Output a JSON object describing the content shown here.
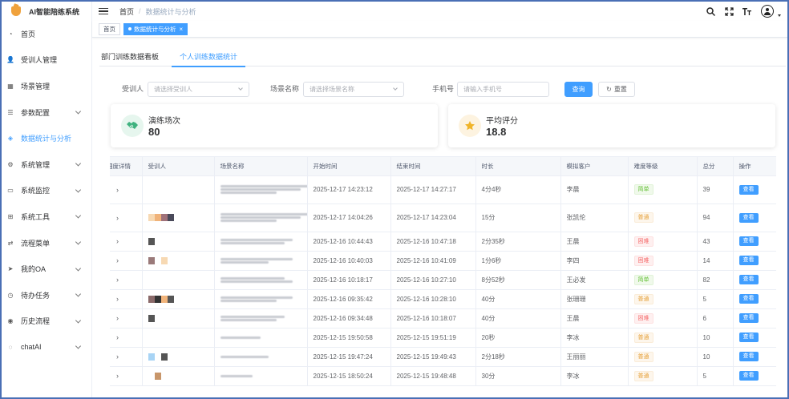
{
  "app": {
    "title": "AI智能陪练系统"
  },
  "sidebar": {
    "items": [
      {
        "label": "首页",
        "icon": "dashboard-icon",
        "glyph": "◔",
        "has_children": false,
        "active": false
      },
      {
        "label": "受训人管理",
        "icon": "user-icon",
        "glyph": "👤",
        "has_children": false,
        "active": false
      },
      {
        "label": "场景管理",
        "icon": "table-icon",
        "glyph": "▦",
        "has_children": false,
        "active": false
      },
      {
        "label": "参数配置",
        "icon": "sliders-icon",
        "glyph": "☰",
        "has_children": true,
        "active": false
      },
      {
        "label": "数据统计与分析",
        "icon": "chart-icon",
        "glyph": "◈",
        "has_children": false,
        "active": true
      },
      {
        "label": "系统管理",
        "icon": "gear-icon",
        "glyph": "⚙",
        "has_children": true,
        "active": false
      },
      {
        "label": "系统监控",
        "icon": "monitor-icon",
        "glyph": "▭",
        "has_children": true,
        "active": false
      },
      {
        "label": "系统工具",
        "icon": "toolbox-icon",
        "glyph": "⊞",
        "has_children": true,
        "active": false
      },
      {
        "label": "流程菜单",
        "icon": "flow-icon",
        "glyph": "⇄",
        "has_children": true,
        "active": false
      },
      {
        "label": "我的OA",
        "icon": "send-icon",
        "glyph": "➤",
        "has_children": true,
        "active": false
      },
      {
        "label": "待办任务",
        "icon": "task-icon",
        "glyph": "◷",
        "has_children": true,
        "active": false
      },
      {
        "label": "历史流程",
        "icon": "eye-icon",
        "glyph": "◉",
        "has_children": true,
        "active": false
      },
      {
        "label": "chatAI",
        "icon": "chat-icon",
        "glyph": "◌",
        "has_children": true,
        "active": false
      }
    ]
  },
  "header": {
    "breadcrumb": {
      "home": "首页",
      "separator": "/",
      "current": "数据统计与分析"
    },
    "icons": [
      "search-icon",
      "fullscreen-icon",
      "font-size-icon"
    ]
  },
  "tags": [
    {
      "label": "首页",
      "active": false
    },
    {
      "label": "数据统计与分析",
      "active": true,
      "close": "×"
    }
  ],
  "tabs": [
    {
      "label": "部门训练数据看板",
      "active": false
    },
    {
      "label": "个人训练数据统计",
      "active": true
    }
  ],
  "filter": {
    "trainee_label": "受训人",
    "trainee_placeholder": "请选择受训人",
    "scene_label": "场景名称",
    "scene_placeholder": "请选择场景名称",
    "phone_label": "手机号",
    "phone_placeholder": "请输入手机号",
    "search_button": "查询",
    "reset_button": "重置",
    "reset_icon": "↻"
  },
  "cards": [
    {
      "label": "演练场次",
      "value": "80",
      "icon": "handshake-icon",
      "glyph": "🤝",
      "color": "#3fb27f",
      "bg": "#e6f6ee"
    },
    {
      "label": "平均评分",
      "value": "18.8",
      "icon": "star-icon",
      "glyph": "★",
      "color": "#f0b429",
      "bg": "#fdf3e0"
    }
  ],
  "table": {
    "columns": [
      "细度详情",
      "受训人",
      "场景名称",
      "开始时间",
      "结束时间",
      "时长",
      "模拟客户",
      "难度等级",
      "总分",
      "操作"
    ],
    "rows": [
      {
        "start": "2025-12-17 14:23:12",
        "end": "2025-12-17 14:27:17",
        "duration": "4分4秒",
        "customer": "李晨",
        "level": "简单",
        "level_type": "easy",
        "score": "39",
        "action": "查看"
      },
      {
        "start": "2025-12-17 14:04:26",
        "end": "2025-12-17 14:23:04",
        "duration": "15分",
        "customer": "张凯伦",
        "level": "普通",
        "level_type": "normal",
        "score": "94",
        "action": "查看"
      },
      {
        "start": "2025-12-16 10:44:43",
        "end": "2025-12-16 10:47:18",
        "duration": "2分35秒",
        "customer": "王晨",
        "level": "困难",
        "level_type": "hard",
        "score": "43",
        "action": "查看"
      },
      {
        "start": "2025-12-16 10:40:03",
        "end": "2025-12-16 10:41:09",
        "duration": "1分6秒",
        "customer": "李四",
        "level": "困难",
        "level_type": "hard",
        "score": "14",
        "action": "查看"
      },
      {
        "start": "2025-12-16 10:18:17",
        "end": "2025-12-16 10:27:10",
        "duration": "8分52秒",
        "customer": "王必发",
        "level": "简单",
        "level_type": "easy",
        "score": "82",
        "action": "查看"
      },
      {
        "start": "2025-12-16 09:35:42",
        "end": "2025-12-16 10:28:10",
        "duration": "40分",
        "customer": "张珊珊",
        "level": "普通",
        "level_type": "normal",
        "score": "5",
        "action": "查看"
      },
      {
        "start": "2025-12-16 09:34:48",
        "end": "2025-12-16 10:18:07",
        "duration": "40分",
        "customer": "王晨",
        "level": "困难",
        "level_type": "hard",
        "score": "6",
        "action": "查看"
      },
      {
        "start": "2025-12-15 19:50:58",
        "end": "2025-12-15 19:51:19",
        "duration": "20秒",
        "customer": "李冰",
        "level": "普通",
        "level_type": "normal",
        "score": "10",
        "action": "查看"
      },
      {
        "start": "2025-12-15 19:47:24",
        "end": "2025-12-15 19:49:43",
        "duration": "2分18秒",
        "customer": "王丽丽",
        "level": "普通",
        "level_type": "normal",
        "score": "10",
        "action": "查看"
      },
      {
        "start": "2025-12-15 18:50:24",
        "end": "2025-12-15 19:48:48",
        "duration": "30分",
        "customer": "李冰",
        "level": "普通",
        "level_type": "normal",
        "score": "5",
        "action": "查看"
      }
    ]
  }
}
